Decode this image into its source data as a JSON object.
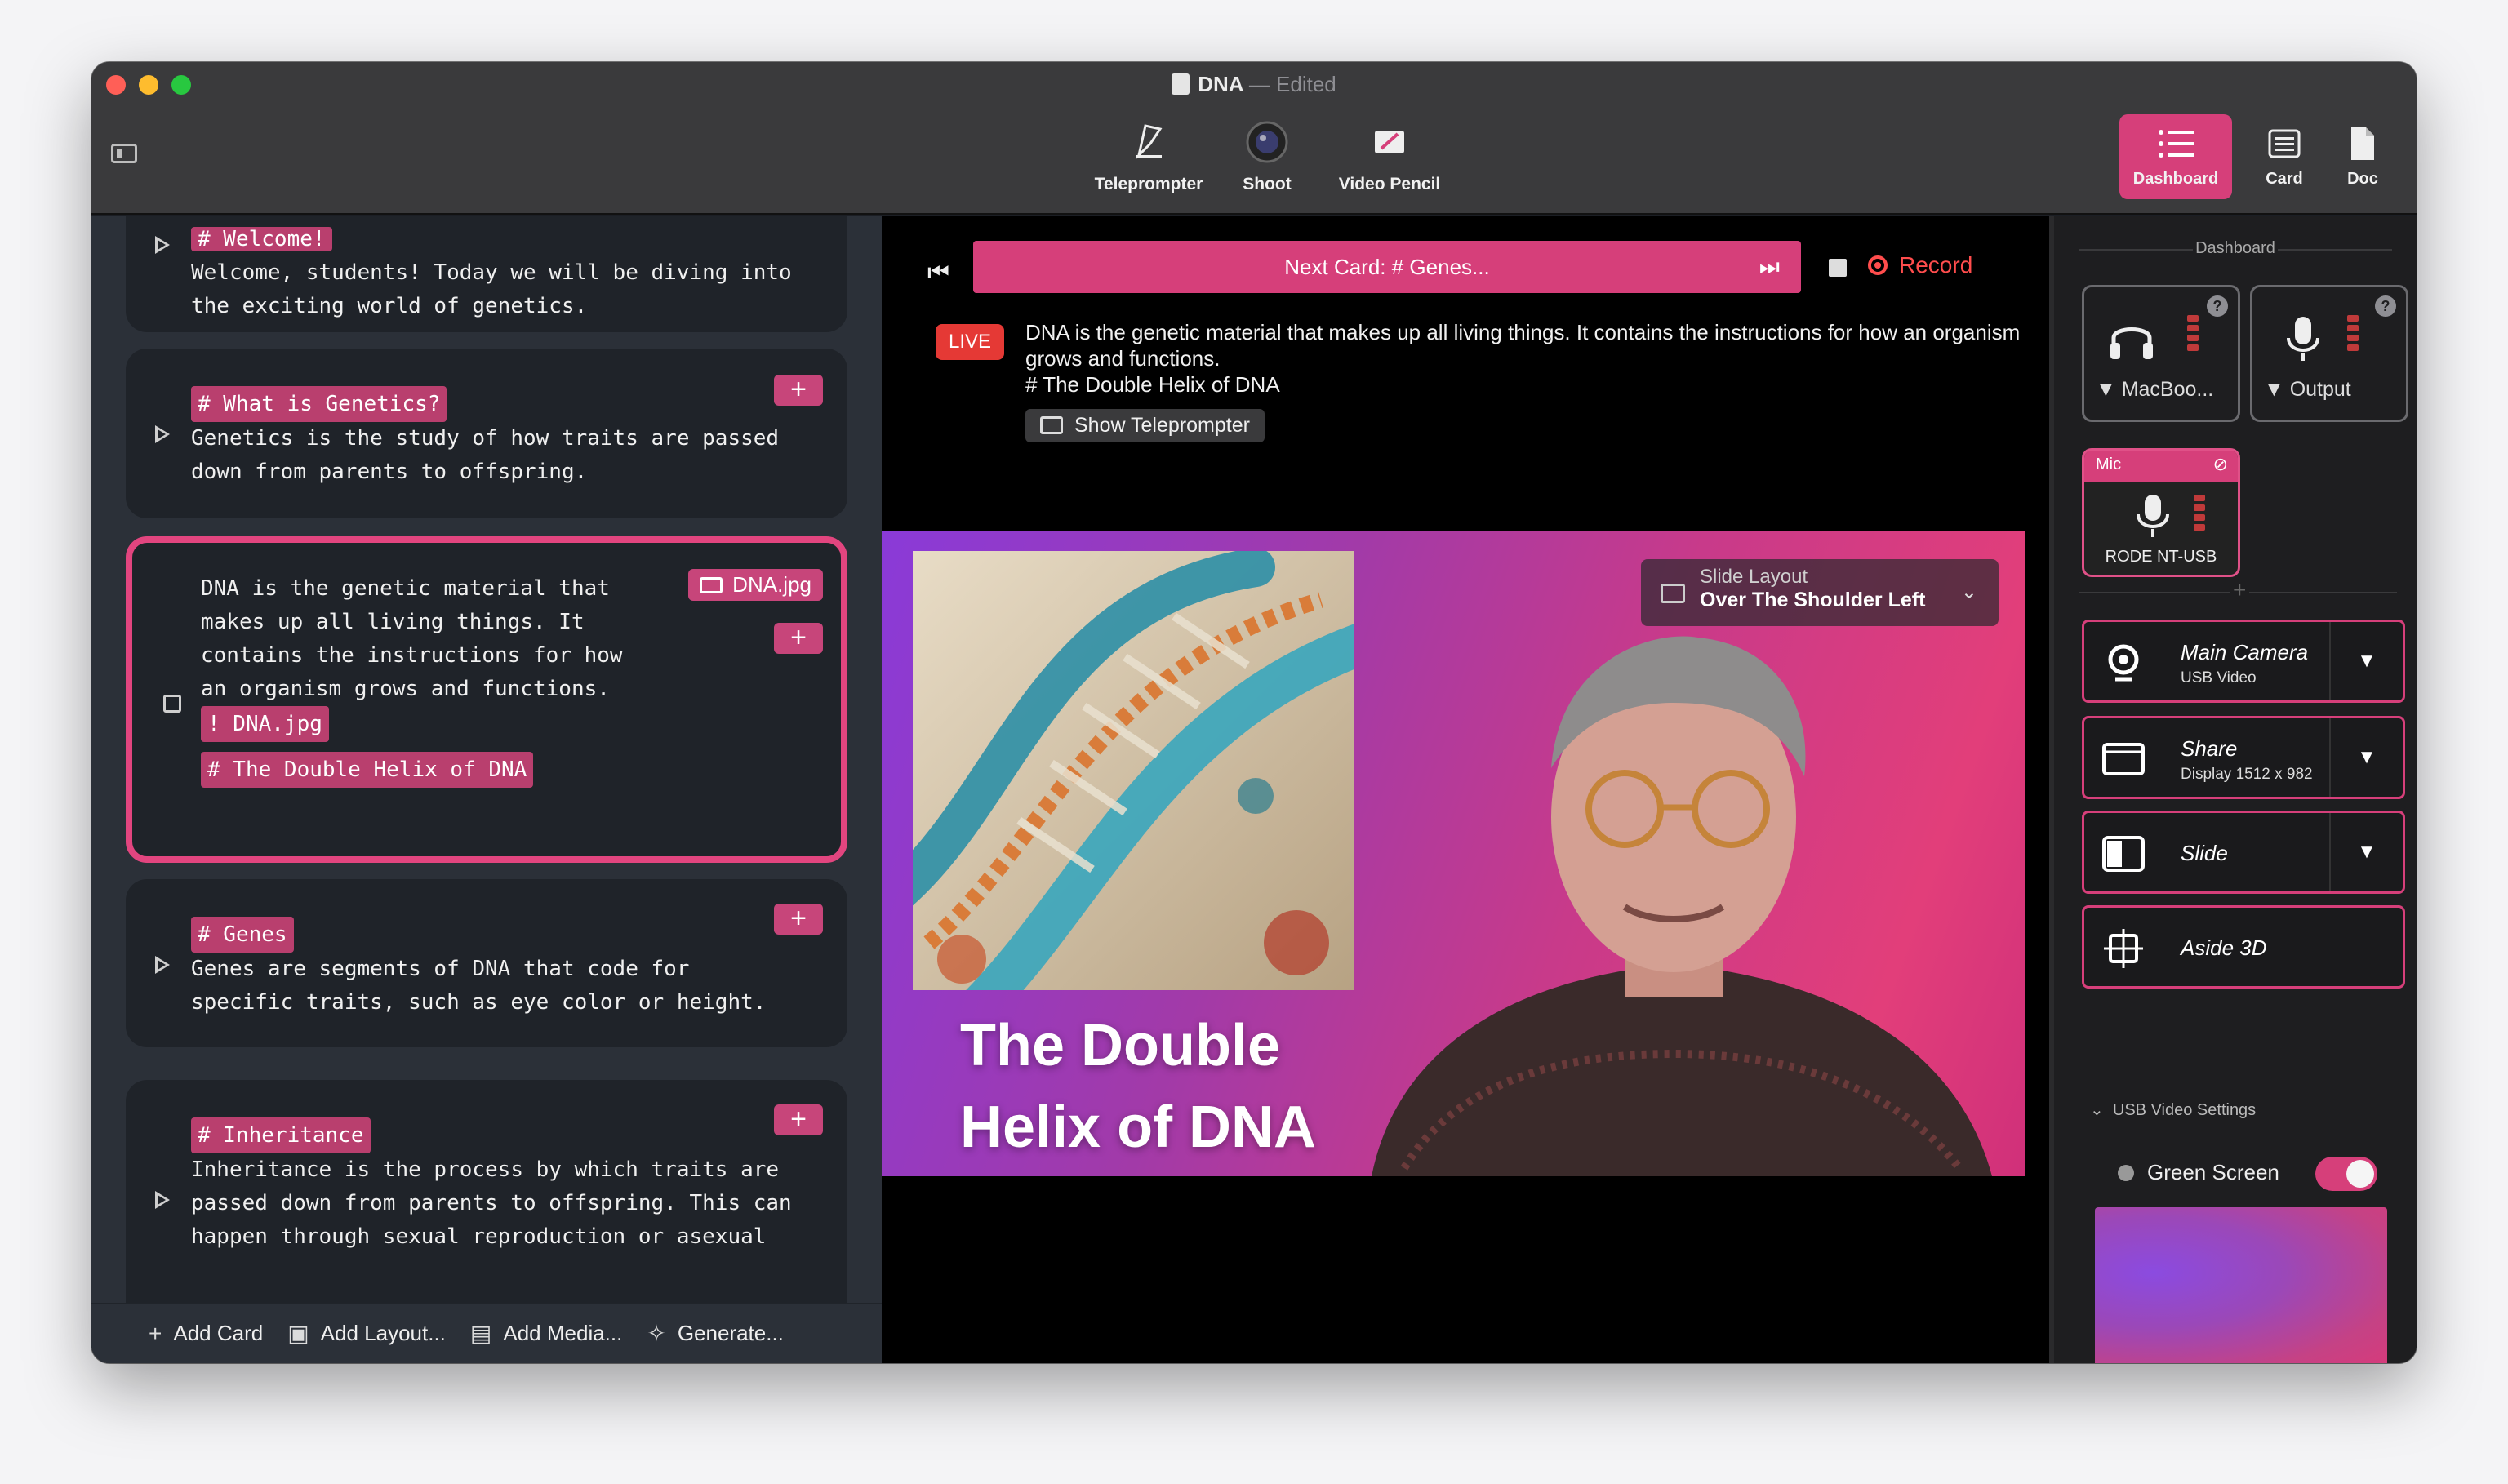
{
  "window": {
    "title": "DNA",
    "title_separator": "—",
    "subtitle": "Edited"
  },
  "toolbar": {
    "center": [
      {
        "label": "Teleprompter",
        "icon": "teleprompter-icon"
      },
      {
        "label": "Shoot",
        "icon": "camera-lens-icon"
      },
      {
        "label": "Video Pencil",
        "icon": "video-pencil-icon"
      }
    ],
    "right": [
      {
        "label": "Dashboard",
        "icon": "list-icon",
        "active": true
      },
      {
        "label": "Card",
        "icon": "card-icon"
      },
      {
        "label": "Doc",
        "icon": "doc-icon"
      }
    ]
  },
  "cards": [
    {
      "header": "# Welcome!",
      "body": "Welcome, students! Today we will be diving into\nthe exciting world of genetics."
    },
    {
      "header": "# What is Genetics?",
      "body": "Genetics is the study of how traits are passed\ndown from parents to offspring."
    },
    {
      "body": "DNA is the genetic material that\nmakes up all living things. It\ncontains the instructions for how\nan organism grows and functions.",
      "file_chip": "DNA.jpg",
      "tag1": "! DNA.jpg",
      "tag2": "# The Double Helix of DNA",
      "active": true
    },
    {
      "header": "# Genes",
      "body": "Genes are segments of DNA that code for\nspecific traits, such as eye color or height."
    },
    {
      "header": "# Inheritance",
      "body": "Inheritance is the process by which traits are\npassed down from parents to offspring. This can\nhappen through sexual reproduction or asexual"
    }
  ],
  "left_bottom": {
    "add_card": "Add Card",
    "add_layout": "Add Layout...",
    "add_media": "Add Media...",
    "generate": "Generate..."
  },
  "player": {
    "next_card": "Next Card:  # Genes...",
    "record": "Record",
    "live": "LIVE",
    "teleprompter_text": "DNA is the genetic material that makes up all living things. It contains the instructions for how an organism grows and functions.",
    "teleprompter_line2": "# The Double Helix of DNA",
    "show_teleprompter": "Show Teleprompter",
    "slide_layout_label": "Slide Layout",
    "slide_layout_value": "Over The Shoulder Left",
    "overlay_line1": "The Double",
    "overlay_line2": "Helix of DNA"
  },
  "dashboard": {
    "section_label": "Dashboard",
    "audio_out": "MacBoo...",
    "audio_output": "Output",
    "mic_header": "Mic",
    "mic_name": "RODE NT-USB",
    "sources": [
      {
        "title": "Main Camera",
        "sub": "USB Video",
        "icon": "webcam-icon",
        "dropdown": true
      },
      {
        "title": "Share",
        "sub": "Display 1512 x 982",
        "icon": "window-icon",
        "dropdown": true
      },
      {
        "title": "Slide",
        "icon": "slide-icon",
        "dropdown": true
      },
      {
        "title": "Aside 3D",
        "icon": "aside-3d-icon",
        "dropdown": false
      }
    ],
    "usb_settings": "USB Video Settings",
    "green_screen": "Green Screen"
  },
  "colors": {
    "accent": "#d63f7a",
    "live": "#e53935",
    "record": "#ff4d4d"
  }
}
